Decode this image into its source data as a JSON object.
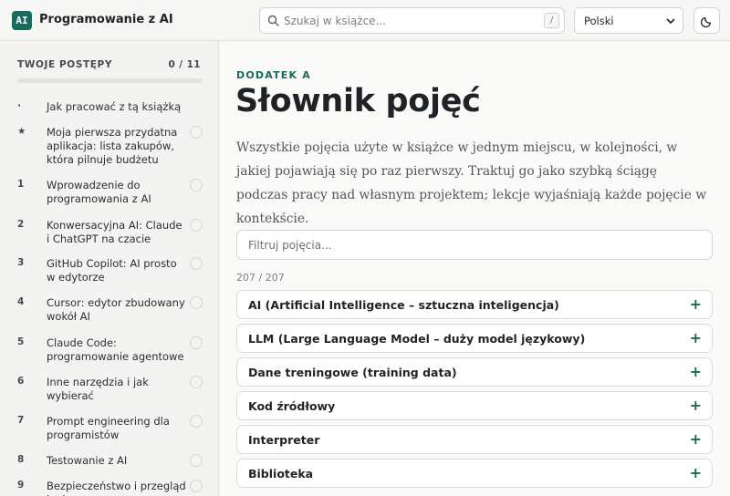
{
  "header": {
    "logo": "AI",
    "title": "Programowanie z AI",
    "search_placeholder": "Szukaj w książce...",
    "search_shortcut": "/",
    "language": "Polski",
    "theme_icon": "moon-icon"
  },
  "sidebar": {
    "progress_label": "TWOJE POSTĘPY",
    "progress_count": "0 / 11",
    "progress_fraction": 0,
    "items": [
      {
        "num": "·",
        "label": "Jak pracować z tą książką",
        "checkbox": false
      },
      {
        "num": "★",
        "label": "Moja pierwsza przydatna aplikacja: lista zakupów, która pilnuje budżetu",
        "checkbox": true
      },
      {
        "num": "1",
        "label": "Wprowadzenie do programowania z AI",
        "checkbox": true
      },
      {
        "num": "2",
        "label": "Konwersacyjna AI: Claude i ChatGPT na czacie",
        "checkbox": true
      },
      {
        "num": "3",
        "label": "GitHub Copilot: AI prosto w edytorze",
        "checkbox": true
      },
      {
        "num": "4",
        "label": "Cursor: edytor zbudowany wokół AI",
        "checkbox": true
      },
      {
        "num": "5",
        "label": "Claude Code: programowanie agentowe",
        "checkbox": true
      },
      {
        "num": "6",
        "label": "Inne narzędzia i jak wybierać",
        "checkbox": true
      },
      {
        "num": "7",
        "label": "Prompt engineering dla programistów",
        "checkbox": true
      },
      {
        "num": "8",
        "label": "Testowanie z AI",
        "checkbox": true
      },
      {
        "num": "9",
        "label": "Bezpieczeństwo i przegląd kodu",
        "checkbox": true
      }
    ]
  },
  "main": {
    "eyebrow": "DODATEK A",
    "title": "Słownik pojęć",
    "lede": "Wszystkie pojęcia użyte w książce w jednym miejscu, w kolejności, w jakiej pojawiają się po raz pierwszy. Traktuj go jako szybką ściągę podczas pracy nad własnym projektem; lekcje wyjaśniają każde pojęcie w kontekście.",
    "filter_placeholder": "Filtruj pojęcia...",
    "count": "207 / 207",
    "terms": [
      {
        "label": "AI (Artificial Intelligence – sztuczna inteligencja)",
        "icon": "+"
      },
      {
        "label": "LLM (Large Language Model – duży model językowy)",
        "icon": "+"
      },
      {
        "label": "Dane treningowe (training data)",
        "icon": "+"
      },
      {
        "label": "Kod źródłowy",
        "icon": "+"
      },
      {
        "label": "Interpreter",
        "icon": "+"
      },
      {
        "label": "Biblioteka",
        "icon": "+"
      }
    ]
  },
  "colors": {
    "accent": "#176b5c",
    "background": "#f3f3f1"
  }
}
